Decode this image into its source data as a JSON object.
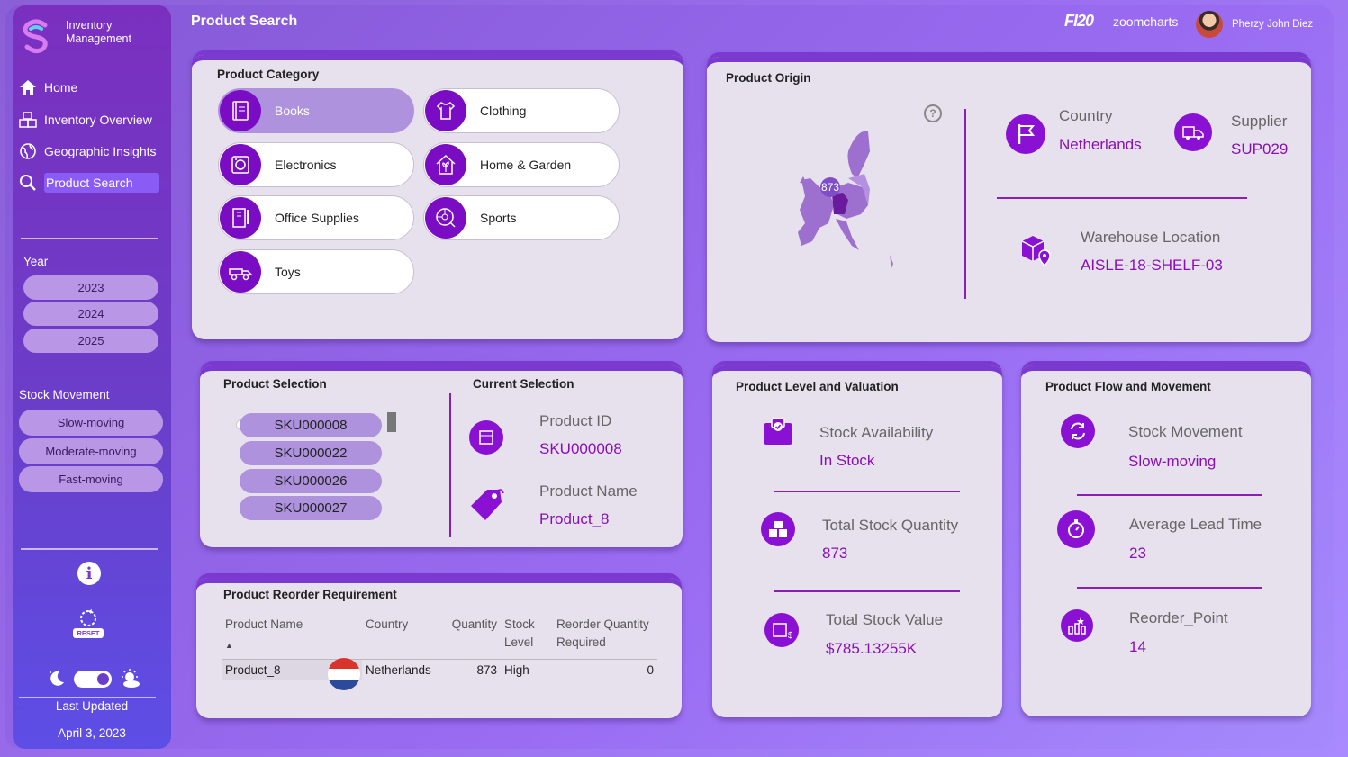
{
  "brand": {
    "line1": "Inventory",
    "line2": "Management"
  },
  "nav": [
    {
      "label": "Home",
      "icon": "home-icon"
    },
    {
      "label": "Inventory Overview",
      "icon": "boxes-icon"
    },
    {
      "label": "Geographic Insights",
      "icon": "globe-icon"
    },
    {
      "label": "Product Search",
      "icon": "magnifier-icon",
      "active": true
    }
  ],
  "year": {
    "title": "Year",
    "options": [
      "2023",
      "2024",
      "2025"
    ]
  },
  "stock_movement": {
    "title": "Stock Movement",
    "options": [
      "Slow-moving",
      "Moderate-moving",
      "Fast-moving"
    ]
  },
  "reset_label": "RESET",
  "last_updated": {
    "label": "Last Updated",
    "value": "April 3, 2023"
  },
  "header": {
    "title": "Product Search",
    "logo1": "FI20",
    "logo2": "zoomcharts",
    "user": "Pherzy John Diez"
  },
  "product_category": {
    "title": "Product Category",
    "items": [
      {
        "label": "Books",
        "icon": "book-icon",
        "selected": true
      },
      {
        "label": "Clothing",
        "icon": "shirt-icon"
      },
      {
        "label": "Electronics",
        "icon": "appliance-icon"
      },
      {
        "label": "Home & Garden",
        "icon": "house-plant-icon"
      },
      {
        "label": "Office Supplies",
        "icon": "notebook-pen-icon"
      },
      {
        "label": "Sports",
        "icon": "ball-icon"
      },
      {
        "label": "Toys",
        "icon": "toy-truck-icon"
      }
    ]
  },
  "product_origin": {
    "title": "Product Origin",
    "map_marker_value": "873",
    "help": "?",
    "country_label": "Country",
    "country_value": "Netherlands",
    "supplier_label": "Supplier",
    "supplier_value": "SUP029",
    "warehouse_label": "Warehouse Location",
    "warehouse_value": "AISLE-18-SHELF-03"
  },
  "product_selection": {
    "title": "Product Selection",
    "skus": [
      "SKU000008",
      "SKU000022",
      "SKU000026",
      "SKU000027"
    ]
  },
  "current_selection": {
    "title": "Current Selection",
    "id_label": "Product ID",
    "id_value": "SKU000008",
    "name_label": "Product Name",
    "name_value": "Product_8"
  },
  "level_valuation": {
    "title": "Product Level and Valuation",
    "availability_label": "Stock Availability",
    "availability_value": "In Stock",
    "qty_label": "Total Stock Quantity",
    "qty_value": "873",
    "value_label": "Total Stock Value",
    "value_value": "$785.13255K"
  },
  "flow_movement": {
    "title": "Product Flow and Movement",
    "movement_label": "Stock Movement",
    "movement_value": "Slow-moving",
    "lead_label": "Average Lead Time",
    "lead_value": "23",
    "reorder_label": "Reorder_Point",
    "reorder_value": "14"
  },
  "reorder": {
    "title": "Product Reorder Requirement",
    "columns": [
      "Product Name",
      "Country",
      "Quantity",
      "Stock Level",
      "Reorder Quantity Required"
    ],
    "rows": [
      {
        "name": "Product_8",
        "country": "Netherlands",
        "quantity": "873",
        "level": "High",
        "reorder": "0"
      }
    ]
  },
  "colors": {
    "accent": "#8a11d4",
    "value_text": "#8a0fb3",
    "pill": "#ae92de"
  }
}
